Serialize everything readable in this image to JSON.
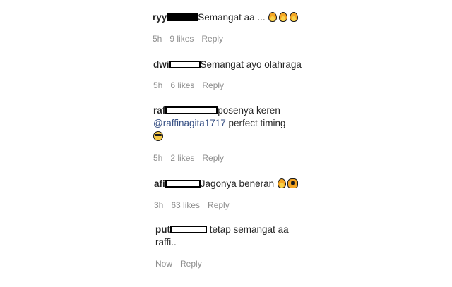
{
  "comments": [
    {
      "username": "ryy",
      "text": "Semangat aa ...",
      "emoji": [
        "fire-emoji",
        "fire-emoji",
        "fire-emoji"
      ],
      "time": "5h",
      "likes": "9 likes",
      "reply": "Reply"
    },
    {
      "username": "dwi",
      "text": "Semangat ayo olahraga",
      "time": "5h",
      "likes": "6 likes",
      "reply": "Reply"
    },
    {
      "username": "raf",
      "text": "posenya keren",
      "mention": "@raffinagita1717",
      "text2": " perfect timing",
      "emoji": [
        "sunglasses-emoji"
      ],
      "time": "5h",
      "likes": "2 likes",
      "reply": "Reply"
    },
    {
      "username": "afi",
      "text": "Jagonya beneran",
      "emoji": [
        "fire-emoji",
        "raised-hands-emoji"
      ],
      "time": "3h",
      "likes": "63 likes",
      "reply": "Reply"
    },
    {
      "username": "put",
      "text": " tetap semangat aa",
      "text_line2": "raffi..",
      "time": "Now",
      "reply": "Reply"
    }
  ]
}
